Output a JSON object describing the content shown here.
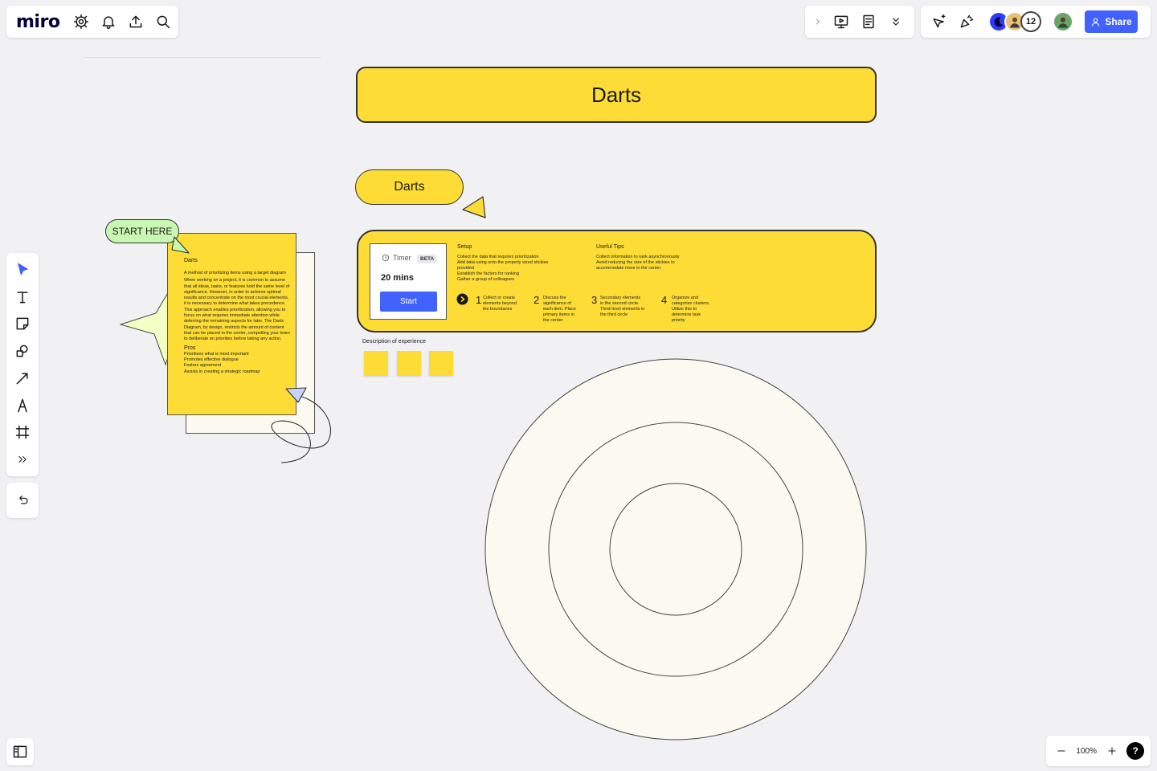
{
  "app": {
    "logo": "miro"
  },
  "top_right": {
    "avatar_count": "12",
    "share_label": "Share"
  },
  "zoom": {
    "level": "100%",
    "help": "?"
  },
  "board": {
    "title_banner": "Darts",
    "darts_pill": "Darts",
    "start_here": "START HERE",
    "timer": {
      "label": "Timer",
      "badge": "BETA",
      "duration": "20 mins",
      "start_label": "Start"
    },
    "setup": {
      "heading": "Setup",
      "lines": [
        "Collect the data that requires prioritization",
        "Add data using onto the properly sized stickies",
        "provided",
        "Establish the factors for ranking",
        "Gather a group of colleagues"
      ]
    },
    "tips": {
      "heading": "Useful Tips",
      "lines": [
        "Collect information to rank asynchronously",
        "Avoid reducing the size of the stickies to",
        "accommodate more in the center"
      ]
    },
    "steps": [
      {
        "num": "1",
        "text": [
          "Collect or create",
          "elements beyond",
          "the boundaries"
        ]
      },
      {
        "num": "2",
        "text": [
          "Discuss the",
          "significance of",
          "each item. Place",
          "primary items in",
          "the center"
        ]
      },
      {
        "num": "3",
        "text": [
          "Secondary elements",
          "in the second circle.",
          "Third-level elements in",
          "the third circle"
        ]
      },
      {
        "num": "4",
        "text": [
          "Organize and",
          "categorize clusters.",
          "Utilize this to",
          "determine task",
          "priority"
        ]
      }
    ],
    "description_label": "Description of experience",
    "doc": {
      "title": "Darts",
      "intro": "A method of prioritizing items using a target diagram",
      "body": "When working on a project, it is common to assume that all ideas, tasks, or features hold the same level of significance. However, in order to achieve optimal results and concentrate on the most crucial elements, it is necessary to determine what takes precedence. This approach enables prioritization, allowing you to focus on what requires immediate attention while deferring the remaining aspects for later. The Darts Diagram, by design, restricts the amount of content that can be placed in the center, compelling your team to deliberate on priorities before taking any action.",
      "pros_title": "Pros",
      "pros": [
        "Prioritizes what is most important",
        "Promotes effective dialogue",
        "Fosters agreement",
        "Assists in creating a strategic roadmap"
      ]
    }
  },
  "colors": {
    "accent_yellow": "#fddc35",
    "primary_blue": "#4262ff",
    "start_green": "#c8f7b1",
    "target_fill": "#fbf9f0"
  }
}
